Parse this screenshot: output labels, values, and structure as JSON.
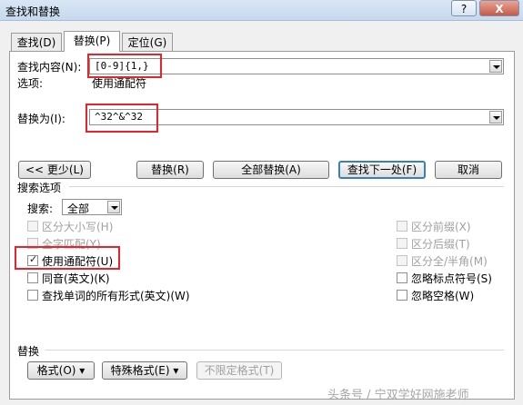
{
  "window": {
    "title": "查找和替换",
    "help_label": "?",
    "close_label": "X"
  },
  "tabs": [
    {
      "label": "查找(D)"
    },
    {
      "label": "替换(P)"
    },
    {
      "label": "定位(G)"
    }
  ],
  "find": {
    "label": "查找内容(N):",
    "value": "[0-9]{1,}",
    "options_label": "选项:",
    "options_value": "使用通配符"
  },
  "replace": {
    "label": "替换为(I):",
    "value": "^32^&^32"
  },
  "buttons": {
    "less": "<< 更少(L)",
    "replace": "替换(R)",
    "replace_all": "全部替换(A)",
    "find_next": "查找下一处(F)",
    "cancel": "取消"
  },
  "search_options": {
    "section_label": "搜索选项",
    "search_label": "搜索:",
    "search_value": "全部"
  },
  "options_left": [
    {
      "label": "区分大小写(H)",
      "checked": false,
      "enabled": false
    },
    {
      "label": "全字匹配(Y)",
      "checked": false,
      "enabled": false
    },
    {
      "label": "使用通配符(U)",
      "checked": true,
      "enabled": true
    },
    {
      "label": "同音(英文)(K)",
      "checked": false,
      "enabled": true
    },
    {
      "label": "查找单词的所有形式(英文)(W)",
      "checked": false,
      "enabled": true
    }
  ],
  "options_right": [
    {
      "label": "区分前缀(X)",
      "checked": false,
      "enabled": false
    },
    {
      "label": "区分后缀(T)",
      "checked": false,
      "enabled": false
    },
    {
      "label": "区分全/半角(M)",
      "checked": false,
      "enabled": false
    },
    {
      "label": "忽略标点符号(S)",
      "checked": false,
      "enabled": true
    },
    {
      "label": "忽略空格(W)",
      "checked": false,
      "enabled": true
    }
  ],
  "replace_section": {
    "label": "替换",
    "format_button": "格式(O) ▾",
    "special_button": "特殊格式(E) ▾",
    "no_format_button": "不限定格式(T)"
  },
  "watermark": "头条号 / 宁双学好网施老师",
  "colors": {
    "highlight_border": "#e8232a",
    "default_button_border": "#3c7fb1"
  }
}
